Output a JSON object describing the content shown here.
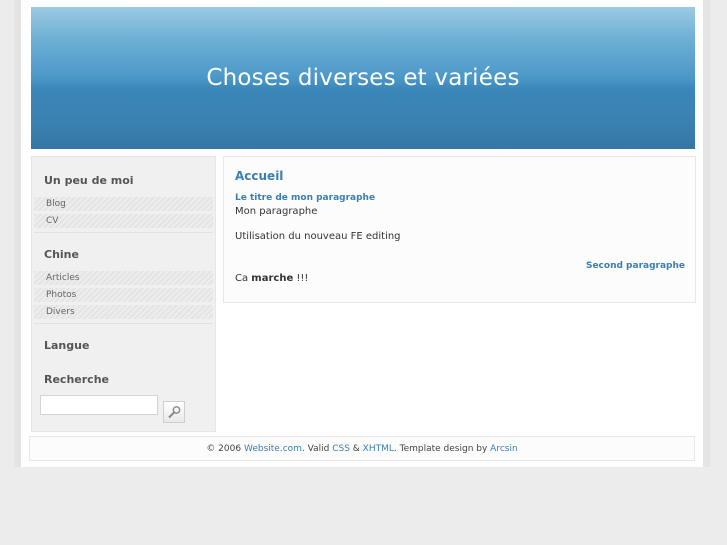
{
  "header": {
    "title": "Choses diverses et variées"
  },
  "sidebar": {
    "section1": {
      "heading": "Un peu de moi",
      "items": [
        {
          "label": "Blog"
        },
        {
          "label": "CV"
        }
      ]
    },
    "section2": {
      "heading": "Chine",
      "items": [
        {
          "label": "Articles"
        },
        {
          "label": "Photos"
        },
        {
          "label": "Divers"
        }
      ]
    },
    "section3": {
      "heading": "Langue"
    },
    "search": {
      "heading": "Recherche",
      "value": ""
    }
  },
  "content": {
    "title": "Accueil",
    "p1_title": "Le titre de mon paragraphe",
    "p1_text": "Mon paragraphe",
    "p1_text2": "Utilisation du nouveau FE editing",
    "p2_title": "Second paragraphe",
    "p2_prefix": "Ca ",
    "p2_bold": "marche",
    "p2_suffix": " !!!"
  },
  "footer": {
    "copyright": "© 2006 ",
    "site_link": "Website.com",
    "valid_text": ". Valid ",
    "css_link": "CSS",
    "amp": " & ",
    "xhtml_link": "XHTML",
    "design_text": ". Template design by ",
    "author_link": "Arcsin"
  },
  "icons": {
    "search_button": "search-icon"
  }
}
